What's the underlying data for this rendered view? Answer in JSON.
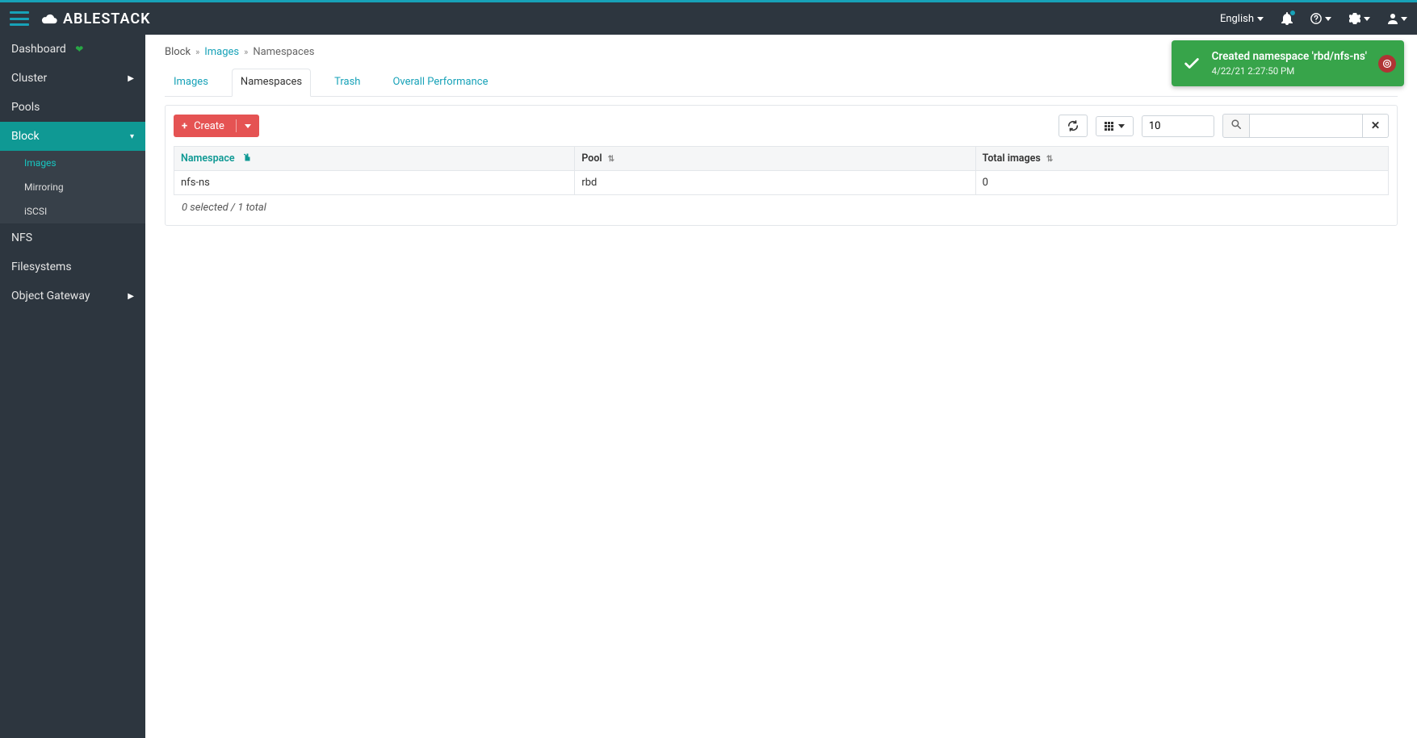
{
  "brand": {
    "text": "ABLESTACK"
  },
  "navbar": {
    "language": "English"
  },
  "sidebar": {
    "dashboard": "Dashboard",
    "cluster": "Cluster",
    "pools": "Pools",
    "block": "Block",
    "block_children": {
      "images": "Images",
      "mirroring": "Mirroring",
      "iscsi": "iSCSI"
    },
    "nfs": "NFS",
    "filesystems": "Filesystems",
    "object_gateway": "Object Gateway"
  },
  "breadcrumb": {
    "root": "Block",
    "images": "Images",
    "current": "Namespaces"
  },
  "tabs": {
    "images": "Images",
    "namespaces": "Namespaces",
    "trash": "Trash",
    "overall_performance": "Overall Performance"
  },
  "toolbar": {
    "create_label": "Create",
    "page_size": "10",
    "search_value": ""
  },
  "table": {
    "columns": {
      "namespace": "Namespace",
      "pool": "Pool",
      "total_images": "Total images"
    },
    "rows": [
      {
        "namespace": "nfs-ns",
        "pool": "rbd",
        "total_images": "0"
      }
    ],
    "footer": "0 selected / 1 total"
  },
  "toast": {
    "title": "Created namespace 'rbd/nfs-ns'",
    "time": "4/22/21 2:27:50 PM"
  }
}
